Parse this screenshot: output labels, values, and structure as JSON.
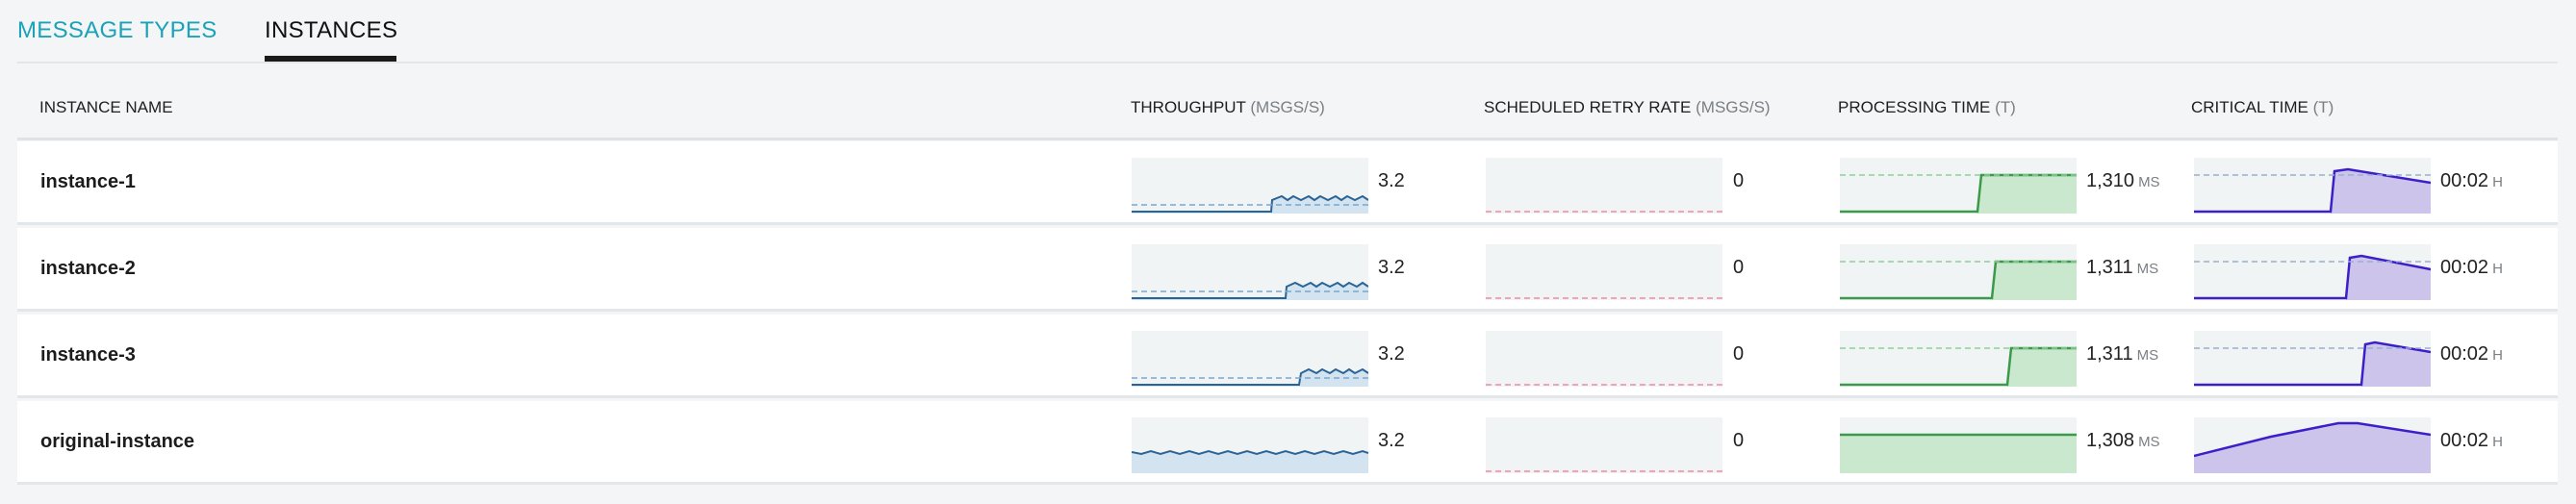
{
  "tabs": [
    {
      "label": "MESSAGE TYPES",
      "active": false
    },
    {
      "label": "INSTANCES",
      "active": true
    }
  ],
  "columns": {
    "name": {
      "label": "INSTANCE NAME"
    },
    "throughput": {
      "label": "THROUGHPUT",
      "unit": "(MSGS/S)"
    },
    "retry": {
      "label": "SCHEDULED RETRY RATE",
      "unit": "(MSGS/S)"
    },
    "processing": {
      "label": "PROCESSING TIME",
      "unit": "(T)"
    },
    "critical": {
      "label": "CRITICAL TIME",
      "unit": "(T)"
    }
  },
  "rows": [
    {
      "name": "instance-1",
      "throughput": "3.2",
      "retry": "0",
      "processing": "1,310",
      "processing_unit": "MS",
      "critical": "00:02",
      "critical_unit": "H"
    },
    {
      "name": "instance-2",
      "throughput": "3.2",
      "retry": "0",
      "processing": "1,311",
      "processing_unit": "MS",
      "critical": "00:02",
      "critical_unit": "H"
    },
    {
      "name": "instance-3",
      "throughput": "3.2",
      "retry": "0",
      "processing": "1,311",
      "processing_unit": "MS",
      "critical": "00:02",
      "critical_unit": "H"
    },
    {
      "name": "original-instance",
      "throughput": "3.2",
      "retry": "0",
      "processing": "1,308",
      "processing_unit": "MS",
      "critical": "00:02",
      "critical_unit": "H"
    }
  ],
  "colors": {
    "tab_active_underline": "#1a1a1a",
    "tab_inactive": "#1aa3b8",
    "throughput_line": "#2a6496",
    "throughput_fill": "#d3e4f0",
    "retry_avg": "#f08aa0",
    "processing_line": "#3a9a4a",
    "processing_fill": "#c9e8cd",
    "critical_line": "#3d1fc9",
    "critical_fill": "#cdc4ec",
    "sparkline_bg": "#f1f4f5",
    "avg_line": "#9aaed0"
  }
}
